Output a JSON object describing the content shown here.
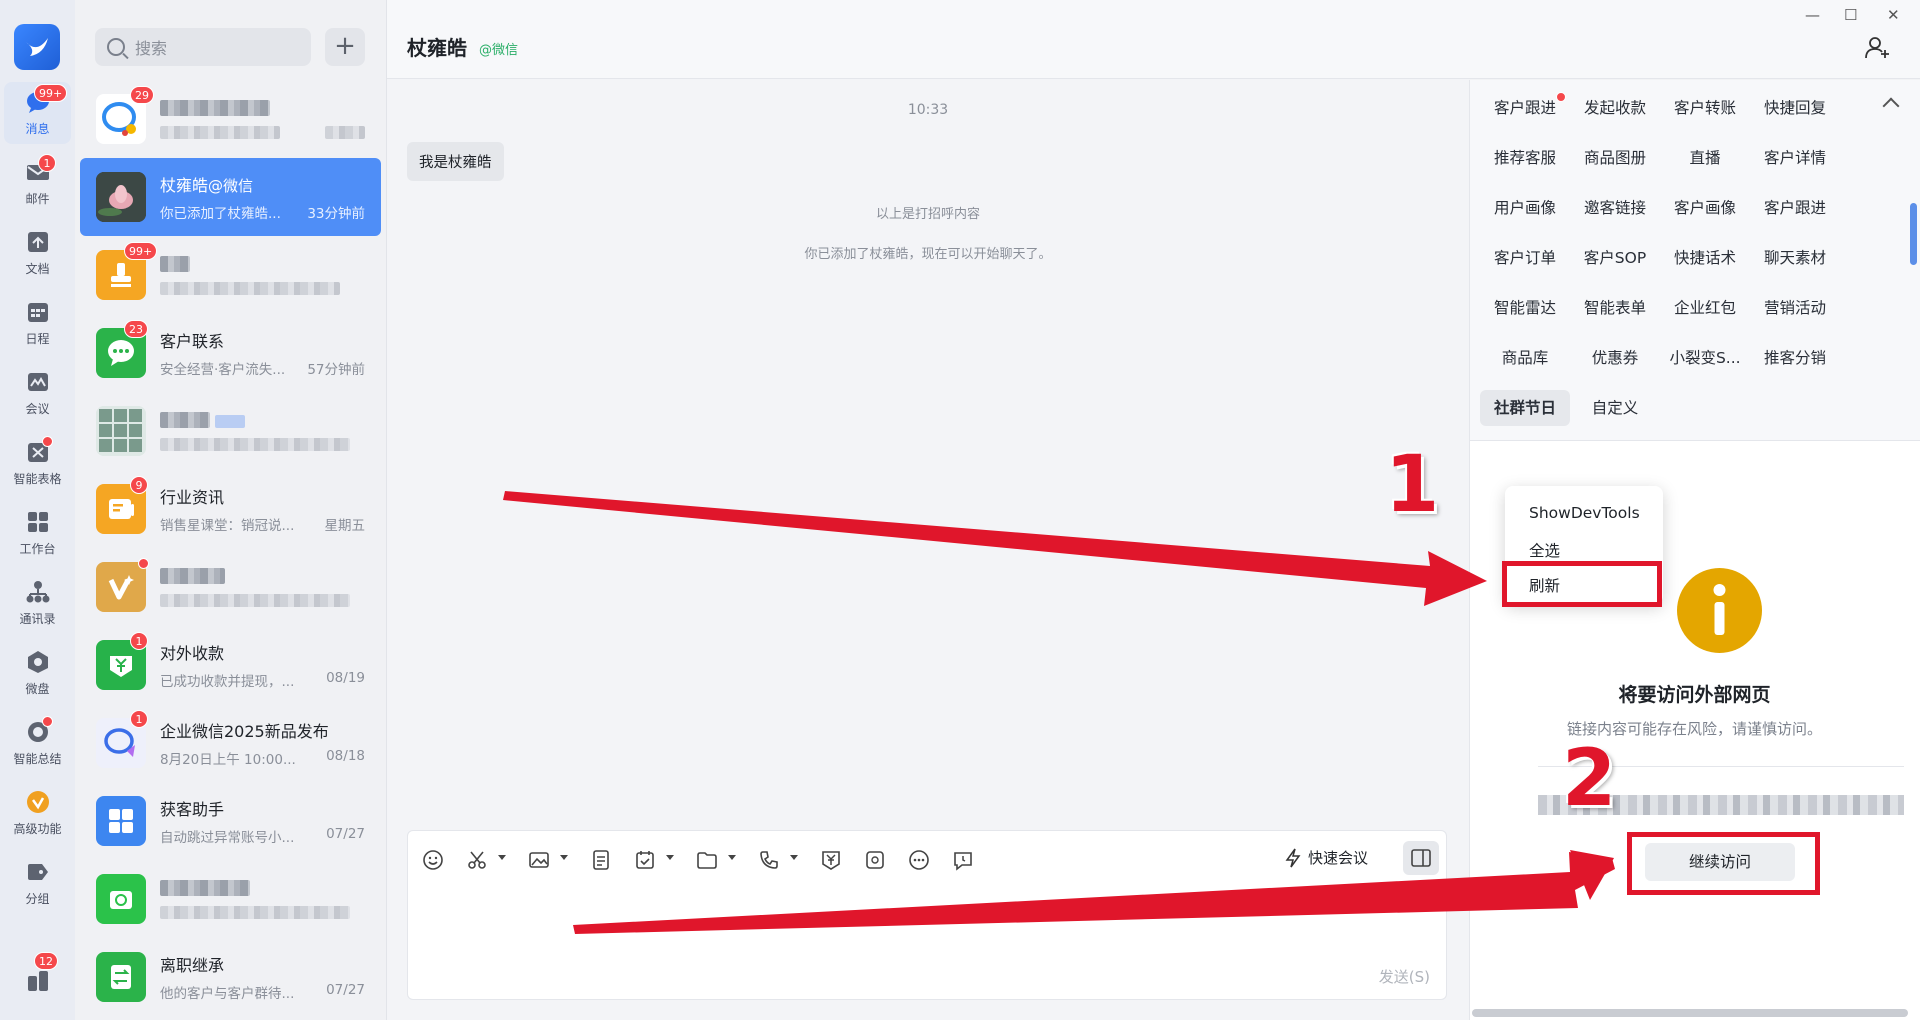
{
  "rail": {
    "items": [
      {
        "label": "消息",
        "badge": "99+"
      },
      {
        "label": "邮件",
        "badge": "1"
      },
      {
        "label": "文档"
      },
      {
        "label": "日程"
      },
      {
        "label": "会议"
      },
      {
        "label": "智能表格"
      },
      {
        "label": "工作台"
      },
      {
        "label": "通讯录"
      },
      {
        "label": "微盘"
      },
      {
        "label": "智能总结"
      },
      {
        "label": "高级功能"
      },
      {
        "label": "分组"
      }
    ],
    "bottom_badge": "12"
  },
  "search": {
    "placeholder": "搜索"
  },
  "add_button": "+",
  "conversations": [
    {
      "badge": "29"
    },
    {
      "name": "杖雍皓",
      "source": "@微信",
      "preview": "你已添加了杖雍皓...",
      "time": "33分钟前"
    },
    {
      "badge": "99+"
    },
    {
      "badge": "23",
      "name": "客户联系",
      "preview": "安全经营·客户流失...",
      "time": "57分钟前"
    },
    {},
    {
      "badge": "9",
      "name": "行业资讯",
      "preview": "销售星课堂：销冠说...",
      "time": "星期五"
    },
    {},
    {
      "badge": "1",
      "name": "对外收款",
      "preview": "已成功收款并提现，...",
      "time": "08/19"
    },
    {
      "badge": "1",
      "name": "企业微信2025新品发布",
      "preview": "8月20日上午 10:00...",
      "time": "08/18"
    },
    {
      "name": "获客助手",
      "preview": "自动跳过异常账号小...",
      "time": "07/27"
    },
    {},
    {
      "name": "离职继承",
      "preview": "他的客户与客户群待...",
      "time": "07/27"
    }
  ],
  "chat": {
    "title": "杖雍皓",
    "source": "@微信",
    "timestamp": "10:33",
    "message": "我是杖雍皓",
    "system_1": "以上是打招呼内容",
    "system_2": "你已添加了杖雍皓，现在可以开始聊天了。",
    "quick_meeting": "快速会议",
    "send": "发送(S)"
  },
  "side_panel": {
    "items": [
      "客户跟进",
      "发起收款",
      "客户转账",
      "快捷回复",
      "推荐客服",
      "商品图册",
      "直播",
      "客户详情",
      "用户画像",
      "邀客链接",
      "客户画像",
      "客户跟进",
      "客户订单",
      "客户SOP",
      "快捷话术",
      "聊天素材",
      "智能雷达",
      "智能表单",
      "企业红包",
      "营销活动",
      "商品库",
      "优惠券",
      "小裂变S...",
      "推客分销",
      "社群节日",
      "自定义"
    ],
    "active": "社群节日"
  },
  "context_menu": [
    "ShowDevTools",
    "全选",
    "刷新"
  ],
  "warning": {
    "title": "将要访问外部网页",
    "desc": "链接内容可能存在风险，请谨慎访问。",
    "continue": "继续访问"
  },
  "annotations": {
    "step1": "1",
    "step2": "2"
  },
  "colors": {
    "accent": "#4f8ef7",
    "badge": "#f5484b",
    "annotation": "#e0162b",
    "info": "#e4a600"
  }
}
